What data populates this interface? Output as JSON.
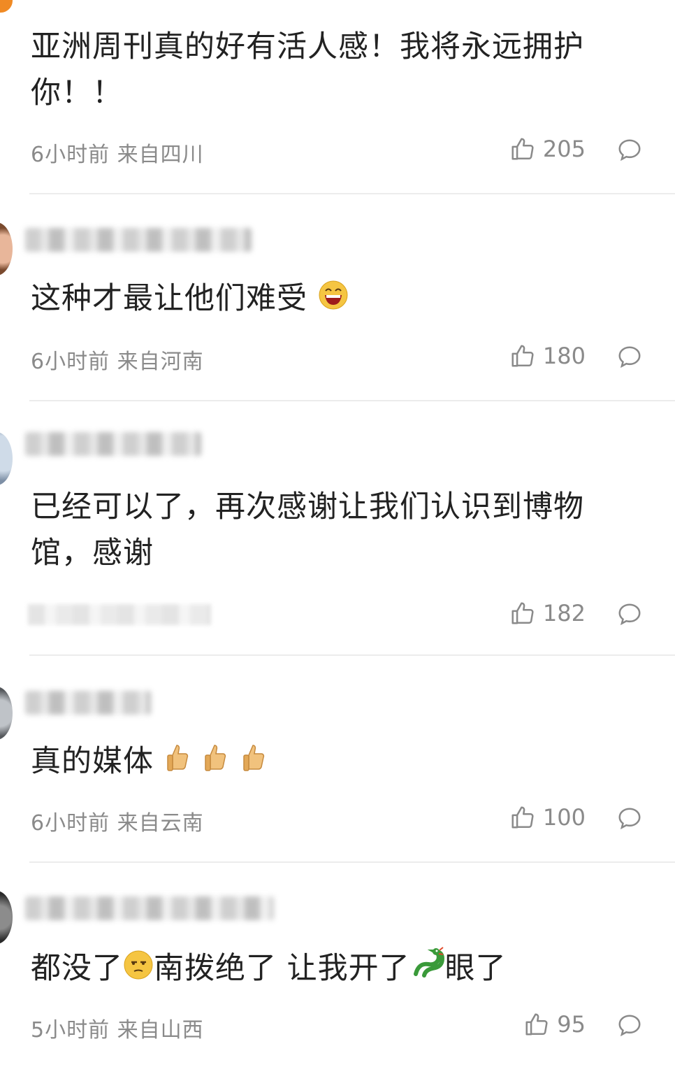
{
  "comments": [
    {
      "text_line1": "亚洲周刊真的好有活人感！我将永远拥护",
      "text_line2": "你！！",
      "meta": "6小时前 来自四川",
      "likes": "205"
    },
    {
      "text": "这种才最让他们难受",
      "meta": "6小时前 来自河南",
      "likes": "180",
      "emoji": "laughing-face"
    },
    {
      "text_line1": "已经可以了，再次感谢让我们认识到博物",
      "text_line2": "馆，感谢",
      "likes": "182"
    },
    {
      "text": "真的媒体",
      "meta": "6小时前 来自云南",
      "likes": "100",
      "emoji": "thumbs-up x3"
    },
    {
      "text_part1": "都没了",
      "text_part2": "南拨绝了 让我开了",
      "text_part3": "眼了",
      "meta": "5小时前 来自山西",
      "likes": "95",
      "emoji": [
        "thinking-face",
        "dragon"
      ]
    }
  ],
  "colors": {
    "text": "#222222",
    "meta": "#8a8a8a",
    "divider": "#ececec",
    "emoji_yellow": "#f5c542",
    "dragon_green": "#3a9a3a"
  }
}
